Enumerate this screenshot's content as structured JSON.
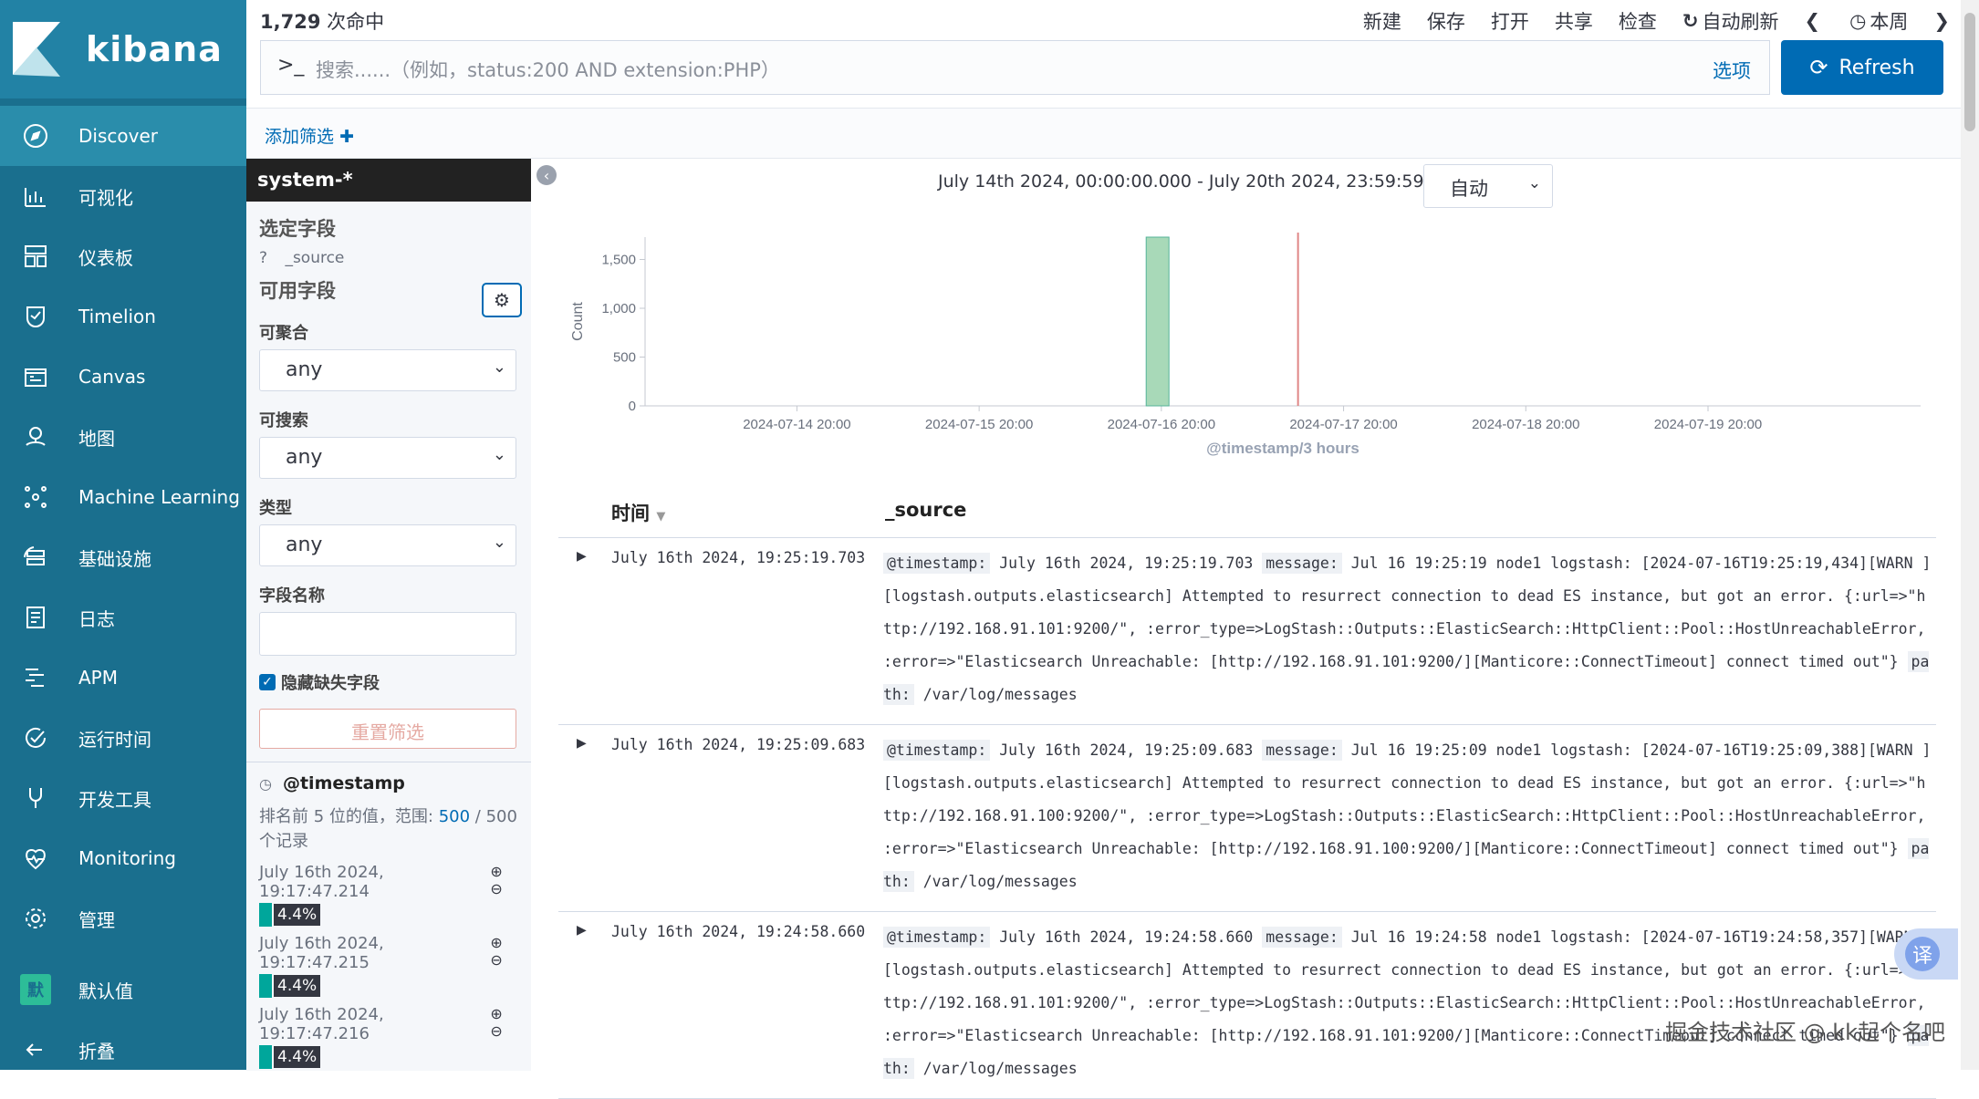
{
  "app": {
    "name": "kibana"
  },
  "nav": {
    "items": [
      {
        "label": "Discover",
        "icon": "compass-icon"
      },
      {
        "label": "可视化",
        "icon": "visualize-icon"
      },
      {
        "label": "仪表板",
        "icon": "dashboard-icon"
      },
      {
        "label": "Timelion",
        "icon": "timelion-icon"
      },
      {
        "label": "Canvas",
        "icon": "canvas-icon"
      },
      {
        "label": "地图",
        "icon": "map-icon"
      },
      {
        "label": "Machine Learning",
        "icon": "ml-icon"
      },
      {
        "label": "基础设施",
        "icon": "infra-icon"
      },
      {
        "label": "日志",
        "icon": "logs-icon"
      },
      {
        "label": "APM",
        "icon": "apm-icon"
      },
      {
        "label": "运行时间",
        "icon": "uptime-icon"
      },
      {
        "label": "开发工具",
        "icon": "devtools-icon"
      },
      {
        "label": "Monitoring",
        "icon": "monitoring-icon"
      },
      {
        "label": "管理",
        "icon": "gear-icon"
      },
      {
        "label": "默认值",
        "icon": "space-badge",
        "badge": "默"
      },
      {
        "label": "折叠",
        "icon": "collapse-icon"
      }
    ]
  },
  "topbar": {
    "hits_count": "1,729",
    "hits_suffix": " 次命中",
    "menu": [
      "新建",
      "保存",
      "打开",
      "共享",
      "检查"
    ],
    "auto_refresh": "自动刷新",
    "this_week": "本周"
  },
  "search": {
    "prompt": ">_",
    "placeholder": "搜索......（例如，status:200 AND extension:PHP）",
    "options": "选项",
    "refresh": "Refresh"
  },
  "filter": {
    "add": "添加筛选"
  },
  "sidebar": {
    "index_pattern": "system-*",
    "selected_fields": "选定字段",
    "source_field_type": "?",
    "source_field": "_source",
    "available_fields": "可用字段",
    "aggregatable": "可聚合",
    "aggregatable_value": "any",
    "searchable": "可搜索",
    "searchable_value": "any",
    "type": "类型",
    "type_value": "any",
    "field_name": "字段名称",
    "hide_missing": "隐藏缺失字段",
    "reset": "重置筛选",
    "timestamp_field": "@timestamp",
    "top5_prefix": "排名前 5 位的值，范围:",
    "top5_count": "500",
    "top5_total": " / 500",
    "top5_suffix": "个记录",
    "values": [
      {
        "value": "July 16th 2024, 19:17:47.214",
        "pct": "4.4%"
      },
      {
        "value": "July 16th 2024, 19:17:47.215",
        "pct": "4.4%"
      },
      {
        "value": "July 16th 2024, 19:17:47.216",
        "pct": "4.4%"
      }
    ]
  },
  "main": {
    "time_range": "July 14th 2024, 00:00:00.000 - July 20th 2024, 23:59:59.999 —",
    "interval": "自动"
  },
  "chart_data": {
    "type": "bar",
    "ylabel": "Count",
    "xlabel": "@timestamp/3 hours",
    "yticks": [
      0,
      500,
      1000,
      1500
    ],
    "ylim": [
      0,
      1729
    ],
    "xticks": [
      "2024-07-14 20:00",
      "2024-07-15 20:00",
      "2024-07-16 20:00",
      "2024-07-17 20:00",
      "2024-07-18 20:00",
      "2024-07-19 20:00"
    ],
    "bars": [
      {
        "x": "2024-07-16 18:00",
        "value": 1729
      }
    ],
    "now_marker": "2024-07-17 14:00",
    "bar_color": "#a8d9b8",
    "marker_color": "#e08787"
  },
  "table": {
    "col_time": "时间",
    "col_source": "_source",
    "rows": [
      {
        "time": "July 16th 2024, 19:25:19.703",
        "ts_key": "@timestamp:",
        "ts_val": " July 16th 2024, 19:25:19.703 ",
        "msg_key": "message:",
        "msg_val": " Jul 16 19:25:19 node1 logstash: [2024-07-16T19:25:19,434][WARN ] [logstash.outputs.elasticsearch] Attempted to resurrect connection to dead ES instance, but got an error. {:url=>\"http://192.168.91.101:9200/\", :error_type=>LogStash::Outputs::ElasticSearch::HttpClient::Pool::HostUnreachableError, :error=>\"Elasticsearch Unreachable: [http://192.168.91.101:9200/][Manticore::ConnectTimeout] connect timed out\"} ",
        "path_key": "path:",
        "path_val": " /var/log/messages"
      },
      {
        "time": "July 16th 2024, 19:25:09.683",
        "ts_key": "@timestamp:",
        "ts_val": " July 16th 2024, 19:25:09.683 ",
        "msg_key": "message:",
        "msg_val": " Jul 16 19:25:09 node1 logstash: [2024-07-16T19:25:09,388][WARN ] [logstash.outputs.elasticsearch] Attempted to resurrect connection to dead ES instance, but got an error. {:url=>\"http://192.168.91.100:9200/\", :error_type=>LogStash::Outputs::ElasticSearch::HttpClient::Pool::HostUnreachableError, :error=>\"Elasticsearch Unreachable: [http://192.168.91.100:9200/][Manticore::ConnectTimeout] connect timed out\"} ",
        "path_key": "path:",
        "path_val": " /var/log/messages"
      },
      {
        "time": "July 16th 2024, 19:24:58.660",
        "ts_key": "@timestamp:",
        "ts_val": " July 16th 2024, 19:24:58.660 ",
        "msg_key": "message:",
        "msg_val": " Jul 16 19:24:58 node1 logstash: [2024-07-16T19:24:58,357][WARN ] [logstash.outputs.elasticsearch] Attempted to resurrect connection to dead ES instance, but got an error. {:url=>\"http://192.168.91.101:9200/\", :error_type=>LogStash::Outputs::ElasticSearch::HttpClient::Pool::HostUnreachableError, :error=>\"Elasticsearch Unreachable: [http://192.168.91.101:9200/][Manticore::ConnectTimeout] connect timed out\"} ",
        "path_key": "path:",
        "path_val": " /var/log/messages"
      }
    ]
  },
  "overlay": {
    "translate": "译",
    "watermark": "掘金技术社区 @ kk起个名吧"
  }
}
